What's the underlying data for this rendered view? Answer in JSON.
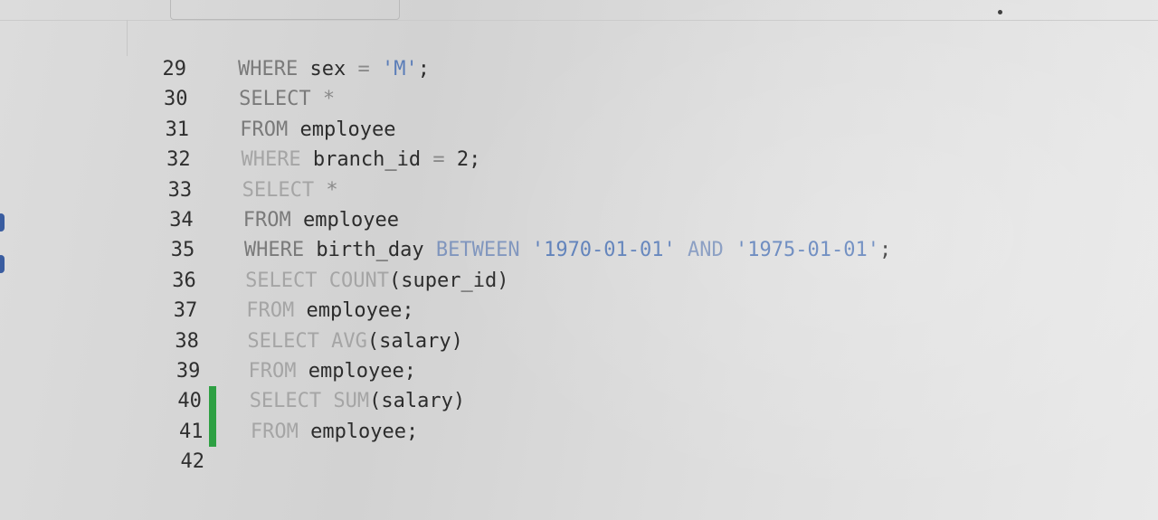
{
  "editor": {
    "lines": [
      {
        "number": "29",
        "tokens": [
          {
            "text": "WHERE",
            "type": "kw"
          },
          {
            "text": " sex ",
            "type": "plain"
          },
          {
            "text": "=",
            "type": "op"
          },
          {
            "text": " ",
            "type": "plain"
          },
          {
            "text": "'M'",
            "type": "str"
          },
          {
            "text": ";",
            "type": "plain"
          }
        ]
      },
      {
        "number": "30",
        "tokens": [
          {
            "text": "SELECT",
            "type": "kw"
          },
          {
            "text": " ",
            "type": "plain"
          },
          {
            "text": "*",
            "type": "op"
          }
        ]
      },
      {
        "number": "31",
        "tokens": [
          {
            "text": "FROM",
            "type": "kw"
          },
          {
            "text": " employee",
            "type": "plain"
          }
        ]
      },
      {
        "number": "32",
        "tokens": [
          {
            "text": "WHERE",
            "type": "kw-faint"
          },
          {
            "text": " branch_id ",
            "type": "plain"
          },
          {
            "text": "=",
            "type": "op"
          },
          {
            "text": " 2;",
            "type": "plain"
          }
        ]
      },
      {
        "number": "33",
        "tokens": [
          {
            "text": "SELECT",
            "type": "kw-faint"
          },
          {
            "text": " ",
            "type": "plain"
          },
          {
            "text": "*",
            "type": "op"
          }
        ]
      },
      {
        "number": "34",
        "tokens": [
          {
            "text": "FROM",
            "type": "kw"
          },
          {
            "text": " employee",
            "type": "plain"
          }
        ]
      },
      {
        "number": "35",
        "tokens": [
          {
            "text": "WHERE",
            "type": "kw"
          },
          {
            "text": " birth_day ",
            "type": "plain"
          },
          {
            "text": "BETWEEN",
            "type": "kw-blue"
          },
          {
            "text": " ",
            "type": "plain"
          },
          {
            "text": "'1970-01-01'",
            "type": "str"
          },
          {
            "text": " ",
            "type": "plain"
          },
          {
            "text": "AND",
            "type": "kw-blue"
          },
          {
            "text": " ",
            "type": "plain"
          },
          {
            "text": "'1975-01-01'",
            "type": "str"
          },
          {
            "text": ";",
            "type": "plain"
          }
        ]
      },
      {
        "number": "36",
        "tokens": [
          {
            "text": "SELECT",
            "type": "kw-faint"
          },
          {
            "text": " ",
            "type": "plain"
          },
          {
            "text": "COUNT",
            "type": "kw-faint"
          },
          {
            "text": "(super_id)",
            "type": "plain"
          }
        ]
      },
      {
        "number": "37",
        "tokens": [
          {
            "text": "FROM",
            "type": "kw-faint"
          },
          {
            "text": " employee;",
            "type": "plain"
          }
        ]
      },
      {
        "number": "38",
        "tokens": [
          {
            "text": "SELECT",
            "type": "kw-faint"
          },
          {
            "text": " ",
            "type": "plain"
          },
          {
            "text": "AVG",
            "type": "kw-faint"
          },
          {
            "text": "(salary)",
            "type": "plain"
          }
        ]
      },
      {
        "number": "39",
        "tokens": [
          {
            "text": "FROM",
            "type": "kw-faint"
          },
          {
            "text": " employee;",
            "type": "plain"
          }
        ]
      },
      {
        "number": "40",
        "modified": true,
        "tokens": [
          {
            "text": "SELECT",
            "type": "kw-faint"
          },
          {
            "text": " ",
            "type": "plain"
          },
          {
            "text": "SUM",
            "type": "kw-faint"
          },
          {
            "text": "(salary)",
            "type": "plain"
          }
        ]
      },
      {
        "number": "41",
        "modified": true,
        "tokens": [
          {
            "text": "FROM",
            "type": "kw-faint"
          },
          {
            "text": " employee;",
            "type": "plain"
          }
        ]
      },
      {
        "number": "42",
        "tokens": []
      }
    ]
  },
  "colors": {
    "modified_marker": "#2ea043",
    "string_literal": "#5a7db8",
    "keyword": "#7a7a7a"
  }
}
